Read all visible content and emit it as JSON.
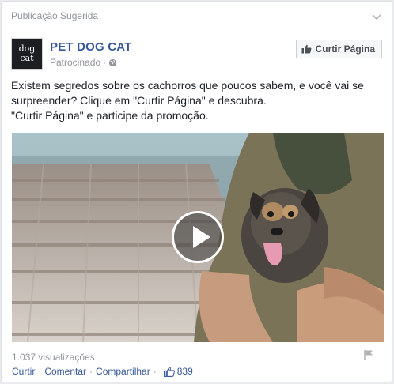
{
  "header": {
    "label": "Publicação Sugerida"
  },
  "page": {
    "avatar_line1": "dog",
    "avatar_line2": "cat",
    "name": "PET DOG CAT",
    "sponsored": "Patrocinado",
    "dot": "·",
    "like_button": "Curtir Página"
  },
  "post": {
    "line1": "Existem segredos sobre os cachorros que poucos sabem, e você vai se",
    "line2": "surpreender? Clique em \"Curtir Página\" e descubra.",
    "line3": "\"Curtir Página\" e participe da promoção."
  },
  "video": {
    "views": "1.037 visualizações"
  },
  "actions": {
    "like": "Curtir",
    "comment": "Comentar",
    "share": "Compartilhar",
    "sep": "·",
    "like_count": "839"
  },
  "colors": {
    "link": "#365899",
    "meta": "#90949c",
    "text": "#1d2129"
  },
  "icons": [
    "chevron-down-icon",
    "globe-icon",
    "thumbs-up-icon",
    "play-icon",
    "flag-icon"
  ]
}
